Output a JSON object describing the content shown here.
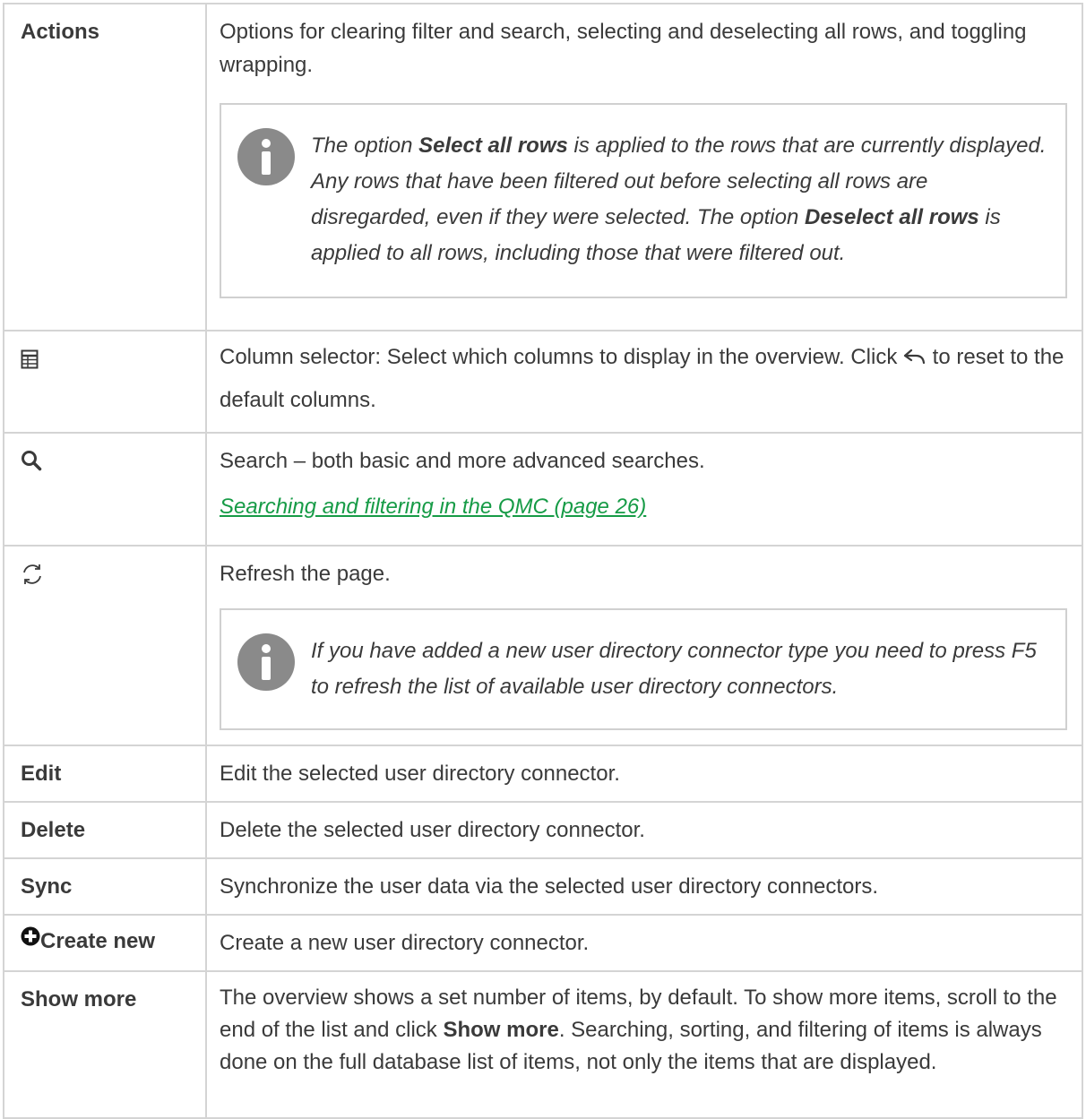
{
  "rows": {
    "actions": {
      "label": "Actions",
      "desc": "Options for clearing filter and search, selecting and deselecting all rows, and toggling wrapping.",
      "note": {
        "t1": "The option ",
        "b1": "Select all rows",
        "t2": " is applied to the rows that are currently displayed. Any rows that have been filtered out before selecting all rows are disregarded, even if they were selected. The option ",
        "b2": "Deselect all rows",
        "t3": " is applied to all rows, including those that were filtered out."
      }
    },
    "column_selector": {
      "icon": "table-icon",
      "desc_before": "Column selector: Select which columns to display in the overview. Click ",
      "undo_icon": "undo-arrow-icon",
      "desc_after": " to reset to the default columns."
    },
    "search": {
      "icon": "search-icon",
      "desc": "Search – both basic and more advanced searches.",
      "link": " Searching and filtering in the QMC (page 26)"
    },
    "refresh": {
      "icon": "refresh-icon",
      "desc": "Refresh the page.",
      "note": "If you have added a new user directory connector type you need to press F5 to refresh the list of available user directory connectors."
    },
    "edit": {
      "label": "Edit",
      "desc": "Edit the selected user directory connector."
    },
    "delete": {
      "label": "Delete",
      "desc": "Delete the selected user directory connector."
    },
    "sync": {
      "label": "Sync",
      "desc": "Synchronize the user data via the selected user directory connectors."
    },
    "create_new": {
      "icon": "plus-circle-icon",
      "label": "Create new",
      "desc": "Create a new user directory connector."
    },
    "show_more": {
      "label": "Show more",
      "t1": "The overview shows a set number of items, by default. To show more items, scroll to the end of the list and click ",
      "b1": "Show more",
      "t2": ". Searching, sorting, and filtering of items is always done on the full database list of items, not only the items that are displayed."
    }
  },
  "colors": {
    "text": "#3a3a3a",
    "border": "#d4d4d4",
    "link": "#169b46",
    "note_icon": "#8a8a8a"
  }
}
